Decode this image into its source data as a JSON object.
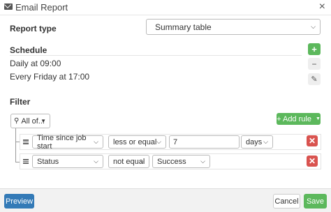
{
  "window": {
    "title": "Email Report",
    "close_glyph": "×",
    "icon": "envelope-icon"
  },
  "report_type": {
    "label": "Report type",
    "value": "Summary table"
  },
  "schedule": {
    "label": "Schedule",
    "items": [
      "Daily at 09:00",
      "Every Friday at 17:00"
    ],
    "add_glyph": "+",
    "remove_glyph": "−",
    "edit_glyph": "✎"
  },
  "filter": {
    "label": "Filter",
    "group_value": "All of...",
    "add_rule_label": "+ Add rule",
    "rules": [
      {
        "field": "Time since job start",
        "operator": "less or equal",
        "value": "7",
        "unit": "days"
      },
      {
        "field": "Status",
        "operator": "not equal",
        "value": "Success"
      }
    ],
    "delete_glyph": "✕"
  },
  "footer": {
    "preview": "Preview",
    "cancel": "Cancel",
    "save": "Save"
  },
  "colors": {
    "green": "#5cb85c",
    "red": "#d9534f",
    "blue": "#337ab7"
  }
}
